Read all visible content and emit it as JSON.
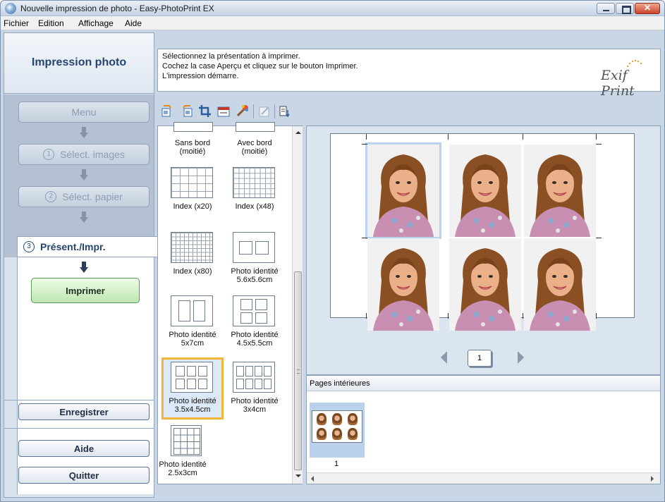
{
  "window": {
    "title": "Nouvelle impression de photo - Easy-PhotoPrint EX"
  },
  "menu": [
    "Fichier",
    "Edition",
    "Affichage",
    "Aide"
  ],
  "sidebar": {
    "header": "Impression photo",
    "steps": {
      "menu": "Menu",
      "step1_num": "1",
      "step1": "Sélect. images",
      "step2_num": "2",
      "step2": "Sélect. papier",
      "step3_num": "3",
      "step3": "Présent./Impr."
    },
    "print_label": "Imprimer",
    "save_label": "Enregistrer",
    "help_label": "Aide",
    "quit_label": "Quitter"
  },
  "instructions": {
    "line1": "Sélectionnez la présentation à imprimer.",
    "line2": "Cochez la case Aperçu et cliquez sur le bouton Imprimer.",
    "line3": "L'impression démarre.",
    "logo": "Exif Print"
  },
  "layouts": [
    {
      "label1": "Sans bord",
      "label2": "(moitié)"
    },
    {
      "label1": "Avec bord",
      "label2": "(moitié)"
    },
    {
      "label1": "Index (x20)",
      "label2": ""
    },
    {
      "label1": "Index (x48)",
      "label2": ""
    },
    {
      "label1": "Index (x80)",
      "label2": ""
    },
    {
      "label1": "Photo identité",
      "label2": "5.6x5.6cm"
    },
    {
      "label1": "Photo identité",
      "label2": "5x7cm"
    },
    {
      "label1": "Photo identité",
      "label2": "4.5x5.5cm"
    },
    {
      "label1": "Photo identité",
      "label2": "3.5x4.5cm"
    },
    {
      "label1": "Photo identité",
      "label2": "3x4cm"
    },
    {
      "label1": "Photo identité",
      "label2": "2.5x3cm"
    }
  ],
  "selected_layout": "Photo identité 3.5x4.5cm",
  "preview": {
    "page_number": "1"
  },
  "pages": {
    "header": "Pages intérieures",
    "page_label": "1"
  },
  "colors": {
    "accent_selection": "#f3b43a",
    "print_button": "#bfe7b1",
    "panel_blue": "#dbe5f0"
  }
}
